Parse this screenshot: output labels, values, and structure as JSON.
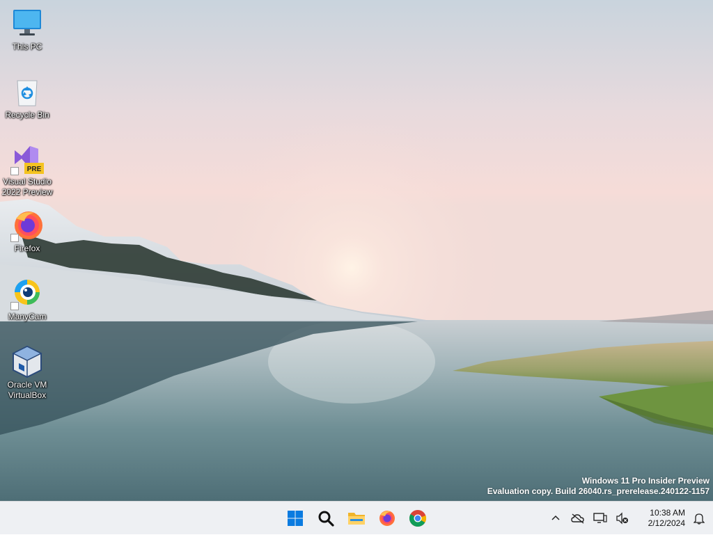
{
  "desktop": {
    "icons": [
      {
        "label": "This PC",
        "icon": "monitor-icon"
      },
      {
        "label": "Recycle Bin",
        "icon": "recycle-bin-icon"
      },
      {
        "label": "Visual Studio 2022 Preview",
        "icon": "visual-studio-icon",
        "badge": "PRE"
      },
      {
        "label": "Firefox",
        "icon": "firefox-icon"
      },
      {
        "label": "ManyCam",
        "icon": "manycam-icon"
      },
      {
        "label": "Oracle VM VirtualBox",
        "icon": "virtualbox-icon"
      }
    ],
    "watermark": {
      "line1": "Windows 11 Pro Insider Preview",
      "line2": "Evaluation copy. Build 26040.rs_prerelease.240122-1157"
    }
  },
  "taskbar": {
    "pinned": [
      {
        "name": "start",
        "icon": "windows-logo-icon"
      },
      {
        "name": "search",
        "icon": "search-icon"
      },
      {
        "name": "file-explorer",
        "icon": "folder-icon"
      },
      {
        "name": "firefox",
        "icon": "firefox-icon"
      },
      {
        "name": "chrome",
        "icon": "chrome-icon"
      }
    ],
    "tray": {
      "icons": [
        "chevron-up-icon",
        "onedrive-offline-icon",
        "network-icon",
        "speaker-muted-icon",
        "bell-icon"
      ],
      "time": "10:38 AM",
      "date": "2/12/2024"
    },
    "background": "#eef0f3"
  }
}
